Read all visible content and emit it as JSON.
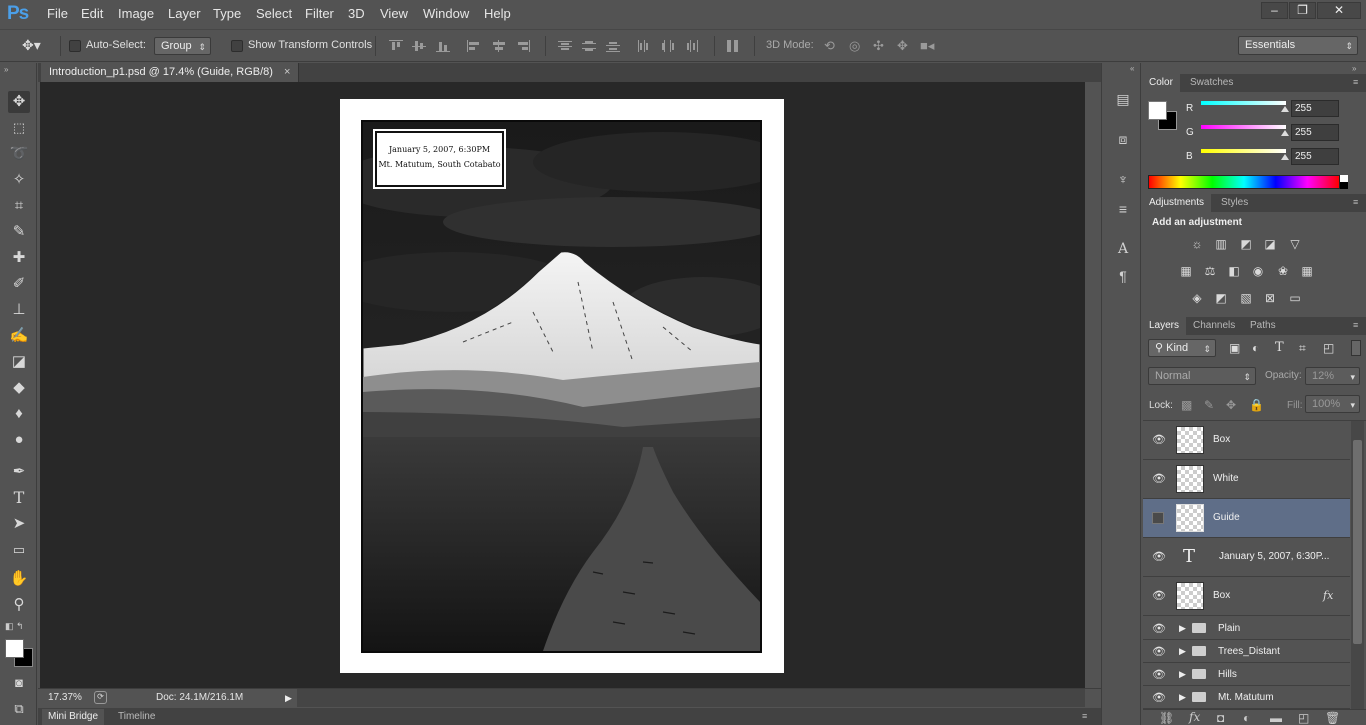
{
  "app": {
    "logo": "Ps"
  },
  "menu": [
    "File",
    "Edit",
    "Image",
    "Layer",
    "Type",
    "Select",
    "Filter",
    "3D",
    "View",
    "Window",
    "Help"
  ],
  "window_controls": {
    "minimize": "–",
    "restore": "❐",
    "close": "✕"
  },
  "options_bar": {
    "auto_select_label": "Auto-Select:",
    "auto_select_value": "Group",
    "show_transform_label": "Show Transform Controls",
    "mode_3d_label": "3D Mode:",
    "workspace": "Essentials"
  },
  "document": {
    "tab_title": "Introduction_p1.psd @ 17.4% (Guide, RGB/8)",
    "caption_date": "January 5, 2007, 6:30PM",
    "caption_place": "Mt. Matutum, South Cotabato"
  },
  "status": {
    "zoom": "17.37%",
    "doc_size": "Doc: 24.1M/216.1M"
  },
  "bottom_tabs": [
    "Mini Bridge",
    "Timeline"
  ],
  "color_panel": {
    "tabs": [
      "Color",
      "Swatches"
    ],
    "channels": [
      {
        "label": "R",
        "value": "255",
        "color": "#00ffff"
      },
      {
        "label": "G",
        "value": "255",
        "color": "#ff00ff"
      },
      {
        "label": "B",
        "value": "255",
        "color": "#ffff00"
      }
    ],
    "foreground": "#ffffff",
    "background": "#000000"
  },
  "adjustments_panel": {
    "tabs": [
      "Adjustments",
      "Styles"
    ],
    "heading": "Add an adjustment",
    "icons": [
      "brightness-icon",
      "levels-icon",
      "curves-icon",
      "exposure-icon",
      "vibrance-icon",
      "hue-saturation-icon",
      "color-balance-icon",
      "black-white-icon",
      "photo-filter-icon",
      "channel-mixer-icon",
      "color-lookup-icon",
      "invert-icon",
      "posterize-icon",
      "threshold-icon",
      "selective-color-icon",
      "gradient-map-icon"
    ]
  },
  "layers_panel": {
    "tabs": [
      "Layers",
      "Channels",
      "Paths"
    ],
    "filter_kind": "Kind",
    "blend_mode": "Normal",
    "opacity_label": "Opacity:",
    "opacity_value": "12%",
    "lock_label": "Lock:",
    "fill_label": "Fill:",
    "fill_value": "100%",
    "fx_label": "fx",
    "layers": [
      {
        "name": "Box",
        "type": "pixel",
        "visible": true,
        "selected": false
      },
      {
        "name": "White",
        "type": "pixel",
        "visible": true,
        "selected": false
      },
      {
        "name": "Guide",
        "type": "pixel",
        "visible": false,
        "selected": true
      },
      {
        "name": "January 5, 2007, 6:30P...",
        "type": "text",
        "visible": true,
        "selected": false
      },
      {
        "name": "Box",
        "type": "pixel",
        "visible": true,
        "selected": false,
        "fx": true
      },
      {
        "name": "Plain",
        "type": "group",
        "visible": true
      },
      {
        "name": "Trees_Distant",
        "type": "group",
        "visible": true
      },
      {
        "name": "Hills",
        "type": "group",
        "visible": true
      },
      {
        "name": "Mt. Matutum",
        "type": "group",
        "visible": true
      }
    ]
  }
}
